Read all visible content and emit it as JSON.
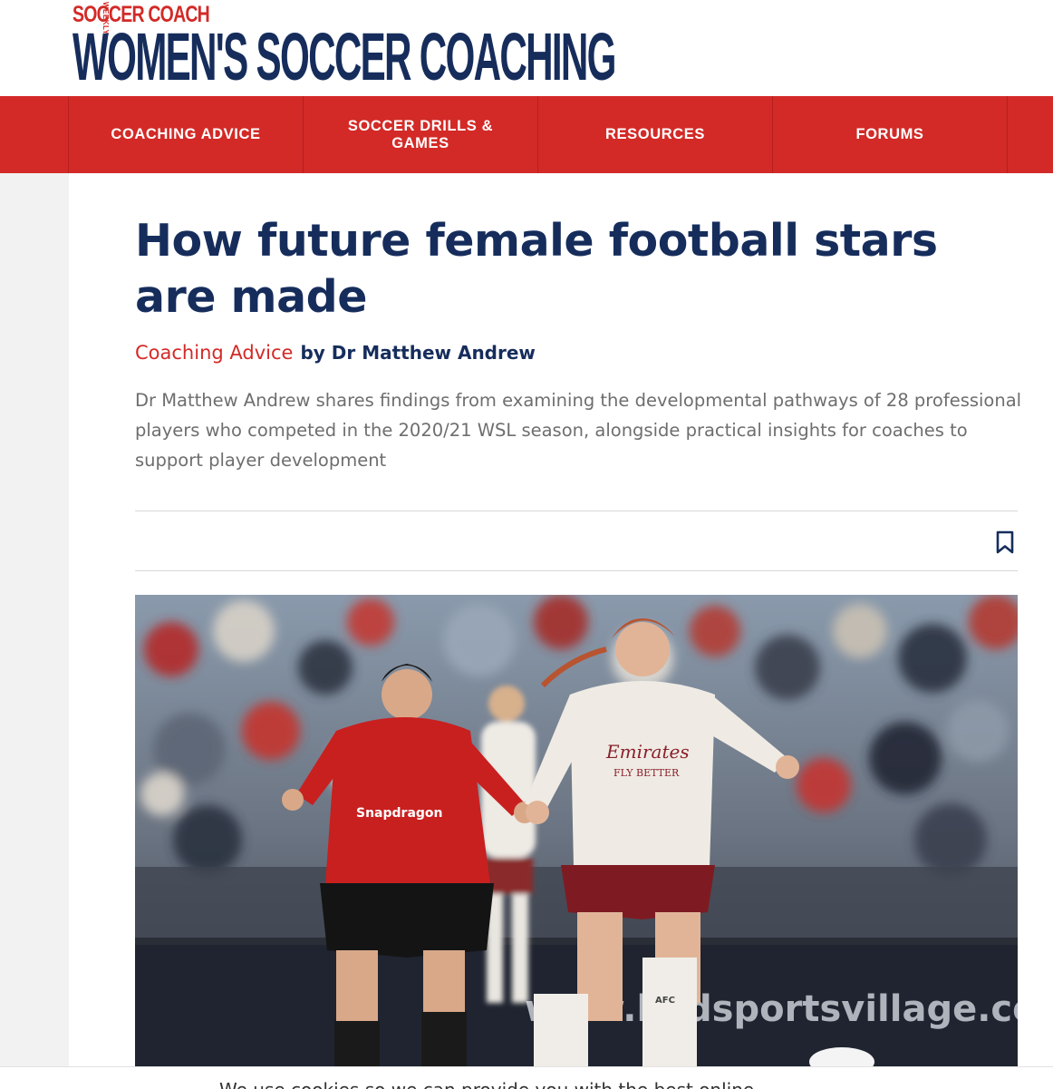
{
  "header": {
    "brand_small": "SOCCER COACH",
    "brand_weekly": "WEEKLY",
    "brand_main": "WOMEN'S SOCCER COACHING"
  },
  "nav": {
    "items": [
      {
        "label": "COACHING ADVICE"
      },
      {
        "label": "SOCCER DRILLS & GAMES"
      },
      {
        "label": "RESOURCES"
      },
      {
        "label": "FORUMS"
      }
    ]
  },
  "article": {
    "title": "How future female football stars are made",
    "category": "Coaching Advice",
    "byline": "by Dr Matthew Andrew",
    "standfirst": "Dr Matthew Andrew shares findings from examining the developmental pathways of 28 professional players who competed in the 2020/21 WSL season, alongside practical insights for coaches to support player development",
    "bookmark_icon": "bookmark-icon"
  },
  "hero": {
    "sponsor_left": "Snapdragon",
    "sponsor_right_1": "Emirates",
    "sponsor_right_2": "FLY BETTER",
    "board_text": "www.leidsportsvillage.co.uk",
    "badge": "AFC"
  },
  "colors": {
    "brand_red": "#d32a27",
    "brand_navy": "#162d5c",
    "text_grey": "#6e6e6e"
  },
  "cookie": {
    "text": "We use cookies so we can provide you with the best online"
  }
}
